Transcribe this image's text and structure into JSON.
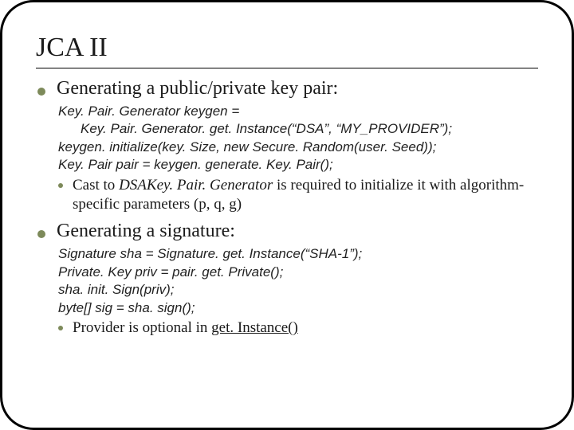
{
  "title": "JCA II",
  "sections": [
    {
      "heading": "Generating a public/private key pair:",
      "code_lines": [
        {
          "text": "Key. Pair. Generator keygen =",
          "indent": false
        },
        {
          "text": "Key. Pair. Generator. get. Instance(“DSA”, “MY_PROVIDER”);",
          "indent": true
        },
        {
          "text": "keygen. initialize(key. Size, new Secure. Random(user. Seed));",
          "indent": false
        },
        {
          "text": "Key. Pair pair = keygen. generate. Key. Pair();",
          "indent": false
        }
      ],
      "sub": {
        "prefix": "Cast to ",
        "italic": "DSAKey. Pair. Generator",
        "suffix": " is required to initialize it with algorithm-specific parameters (p, q, g)"
      }
    },
    {
      "heading": "Generating a signature:",
      "code_lines": [
        {
          "text": "Signature sha = Signature. get. Instance(“SHA-1”);",
          "indent": false
        },
        {
          "text": "Private. Key priv = pair. get. Private();",
          "indent": false
        },
        {
          "text": "sha. init. Sign(priv);",
          "indent": false
        },
        {
          "text": "byte[] sig = sha. sign();",
          "indent": false
        }
      ],
      "sub": {
        "prefix": "Provider is optional in ",
        "underline": "get. Instance()",
        "suffix": ""
      }
    }
  ]
}
